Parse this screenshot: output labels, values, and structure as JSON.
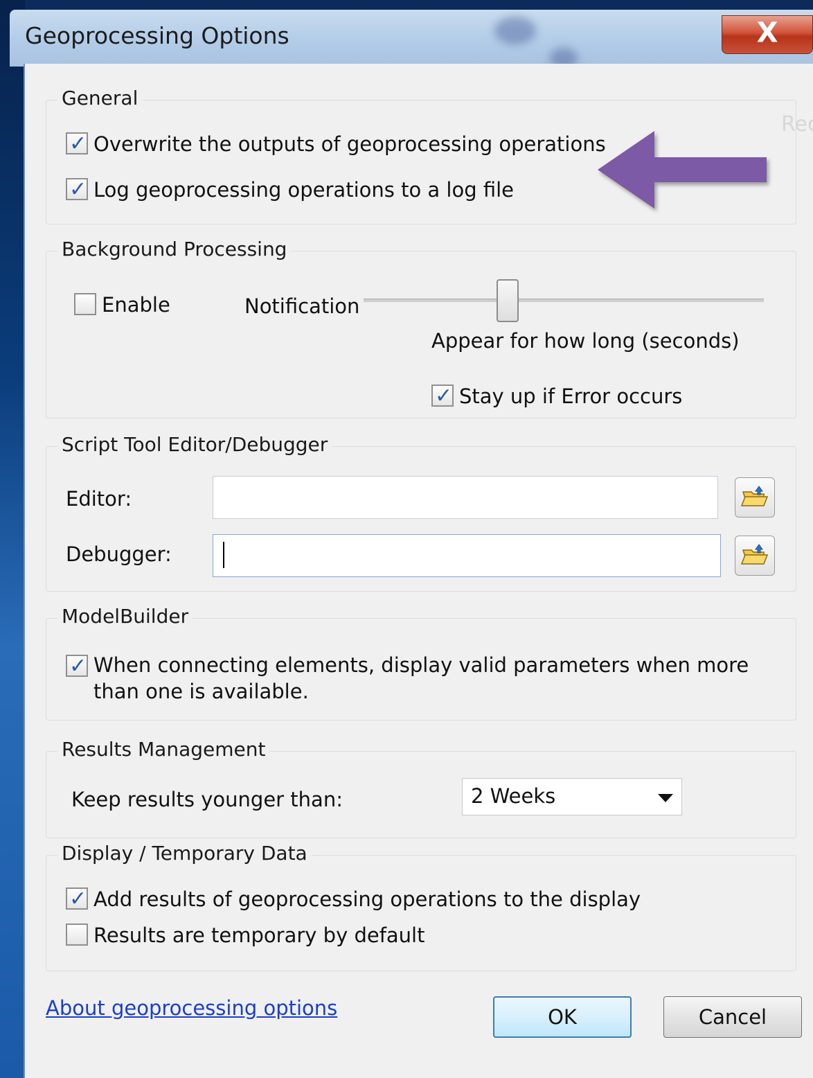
{
  "window": {
    "title": "Geoprocessing Options",
    "close_glyph": "X"
  },
  "ghost_text": "Rec",
  "general": {
    "label": "General",
    "overwrite": {
      "label": "Overwrite the outputs of geoprocessing operations",
      "checked": true
    },
    "log": {
      "label": "Log geoprocessing operations to a log file",
      "checked": true
    }
  },
  "background": {
    "label": "Background Processing",
    "enable": {
      "label": "Enable",
      "checked": false
    },
    "notification_label": "Notification",
    "slider_level": 0.36,
    "appear_label": "Appear for how long (seconds)",
    "stay_up": {
      "label": "Stay up if Error occurs",
      "checked": true
    }
  },
  "script_tool": {
    "label": "Script Tool Editor/Debugger",
    "editor_label": "Editor:",
    "editor_value": "",
    "debugger_label": "Debugger:",
    "debugger_value": ""
  },
  "modelbuilder": {
    "label": "ModelBuilder",
    "valid_params": {
      "label": "When connecting elements, display valid parameters when more than one is available.",
      "checked": true
    }
  },
  "results": {
    "label": "Results Management",
    "keep_label": "Keep results younger than:",
    "keep_value": "2 Weeks"
  },
  "display": {
    "label": "Display / Temporary Data",
    "add_results": {
      "label": "Add results of geoprocessing operations to the display",
      "checked": true
    },
    "temporary": {
      "label": "Results are temporary by default",
      "checked": false
    }
  },
  "footer": {
    "about_link": "About geoprocessing options",
    "ok_label": "OK",
    "cancel_label": "Cancel"
  },
  "annotation_arrow_color": "#7b5aa6",
  "check_glyph": "✓"
}
